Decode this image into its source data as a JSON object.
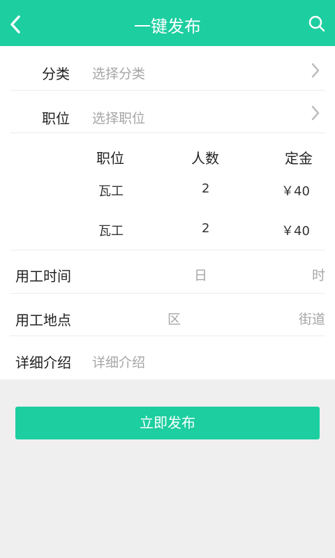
{
  "header": {
    "title": "一键发布",
    "back_icon": "chevron-left-icon",
    "search_icon": "search-icon"
  },
  "form": {
    "category": {
      "label": "分类",
      "placeholder": "选择分类"
    },
    "position": {
      "label": "职位",
      "placeholder": "选择职位"
    },
    "job_table": {
      "headers": [
        "职位",
        "人数",
        "定金"
      ],
      "rows": [
        {
          "position": "瓦工",
          "count": "2",
          "deposit": "￥40"
        },
        {
          "position": "瓦工",
          "count": "2",
          "deposit": "￥40"
        }
      ]
    },
    "work_time": {
      "label": "用工时间",
      "day_placeholder": "日",
      "hour_placeholder": "时"
    },
    "work_location": {
      "label": "用工地点",
      "district_placeholder": "区",
      "street_placeholder": "街道"
    },
    "details": {
      "label": "详细介绍",
      "placeholder": "详细介绍"
    }
  },
  "submit_label": "立即发布",
  "colors": {
    "accent": "#1ccea0",
    "background": "#efefef"
  }
}
